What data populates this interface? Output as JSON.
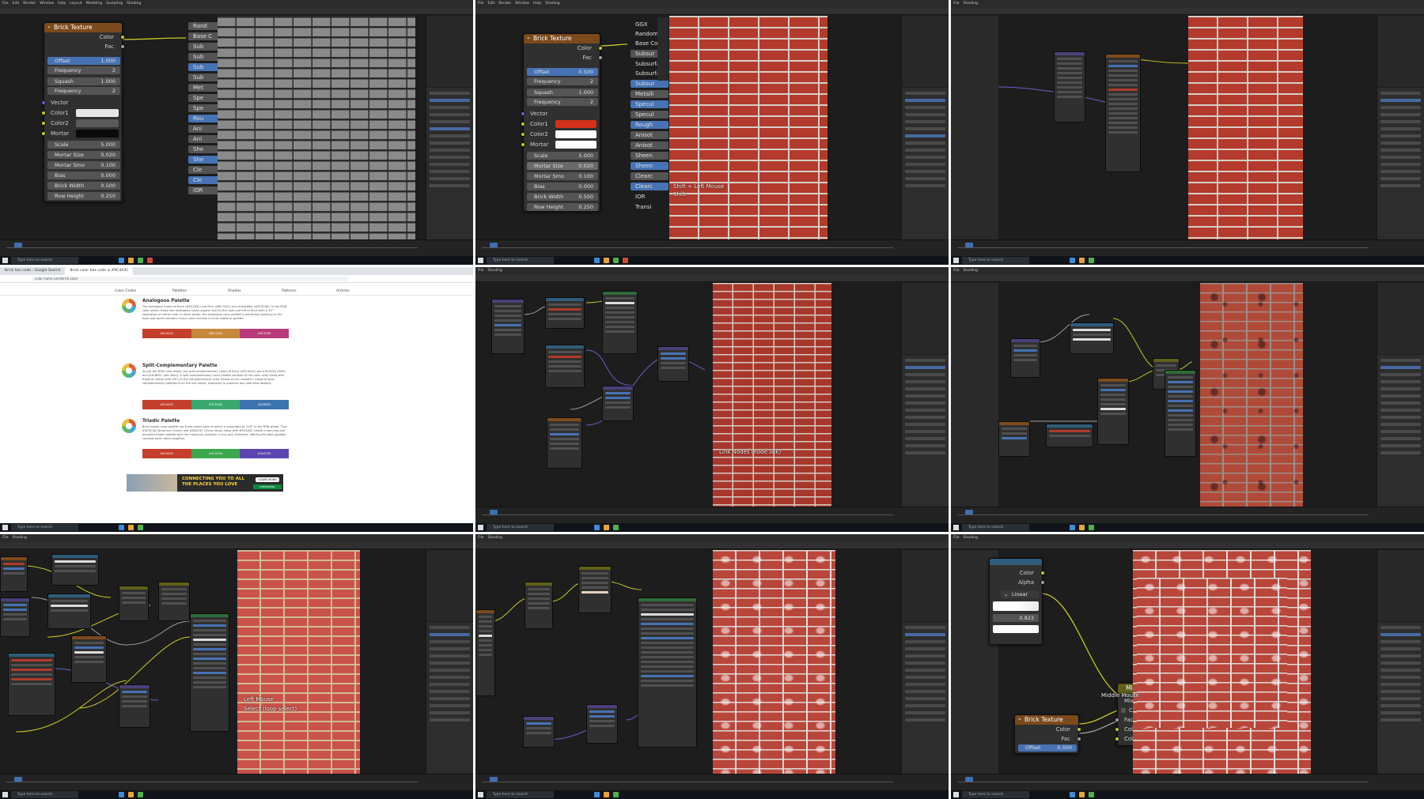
{
  "taskbar": {
    "search_placeholder": "Type here to search"
  },
  "brick_node": {
    "title": "Brick Texture",
    "out_color": "Color",
    "out_fac": "Fac",
    "offset_label": "Offset",
    "frequency_label": "Frequency",
    "squash_label": "Squash",
    "vector_label": "Vector",
    "color1_label": "Color1",
    "color2_label": "Color2",
    "mortar_label": "Mortar",
    "scale_label": "Scale",
    "mortar_size_label": "Mortar Size",
    "mortar_smooth_label": "Mortar Smo",
    "bias_label": "Bias",
    "brick_width_label": "Brick Width",
    "row_height_label": "Row Height"
  },
  "tile1": {
    "offset": "1.000",
    "frequency": "2",
    "squash": "1.000",
    "squash_frequency": "2",
    "scale": "5.000",
    "mortar_size": "0.020",
    "mortar_smooth": "0.100",
    "bias": "0.000",
    "brick_width": "0.500",
    "row_height": "0.250",
    "colors": {
      "color1": "#e6e6e6",
      "color2": "#5a5a5a",
      "mortar": "#0a0a0a"
    },
    "principled_inputs": [
      "Rand",
      "Base C",
      "Sub",
      "Sub",
      "Sub",
      "Sub",
      "Met",
      "Spe",
      "Spe",
      "Rou",
      "Ani",
      "Ani",
      "She",
      "She",
      "Cle",
      "Cle",
      "IOR"
    ]
  },
  "tile2": {
    "offset": "0.500",
    "frequency": "2",
    "squash": "1.000",
    "squash_frequency": "2",
    "scale": "5.000",
    "mortar_size": "0.020",
    "mortar_smooth": "0.100",
    "bias": "0.000",
    "brick_width": "0.500",
    "row_height": "0.250",
    "colors": {
      "color1": "#d4301c",
      "color2": "#ffffff",
      "mortar": "#ffffff"
    },
    "principled_inputs": [
      "GGX",
      "Random",
      "Base Colo",
      "Subsur",
      "Subsurfa",
      "Subsurfa",
      "Subsur",
      "Metalli",
      "Specul",
      "Specul",
      "Rough",
      "Anisot",
      "Anisot",
      "Sheen",
      "Sheen",
      "Clearc",
      "Clearc",
      "IOR",
      "Transi"
    ],
    "overlay_hint": "Shift + Left Mouse",
    "overlay_key": "Shift"
  },
  "tile4_browser": {
    "tabs": [
      "Brick hex code - Google Search",
      "Brick color hex code is #9C4A3C"
    ],
    "url": "color-name.com/brick.color",
    "nav": [
      "Color Codes",
      "Palettes",
      "Shades",
      "Patterns",
      "Articles"
    ],
    "palettes": [
      {
        "title": "Analogous Palette",
        "text": "The analogous colors of Brick (#9C4A3C) are Peru (#BC7A3C) and Irresistible (#9C3C6E). In the RGB color wheel, these two analogous colors appear next to the right and left of Brick with a 30° separation on either side. In other words, the analogous color palette is extremely soothing to the eyes and works wonders if your color scheme is to be subtle or quieter.",
        "swatches": [
          "#9C4A3C",
          "#BC7A3C",
          "#9C3C6E"
        ],
        "colors": [
          "#c4402c",
          "#c8883c",
          "#b83a78"
        ]
      },
      {
        "title": "Split-Complementary Palette",
        "text": "As per the RGB color wheel, the split-complementary colors of Brick (#9C4A3C) are #3C9C6A (Mint) and #3C6E9C (Ibm Blue). A split-complementary color palette consists of the main color along with those on either side (30°) of the complementary color. Based on our research, usage of split-complementary palettes is on the rise online, especially in graphics and web sites designs.",
        "swatches": [
          "#9C4A3C",
          "#3C9C6A",
          "#3C6E9C"
        ],
        "colors": [
          "#c4402c",
          "#3aa86e",
          "#3c74b0"
        ]
      },
      {
        "title": "Triadic Palette",
        "text": "Brick triadic color palette has three colors each of which is separated by 120° in the RGB wheel. Thus #3C9C4A (American Green) and #4A3C9C (Ocean Blue) along with #9C4A3C create a stunning and beautiful triadic palette with the maximum variation in hue and, therefore, offering the best possible contrast when taken together.",
        "swatches": [
          "#9C4A3C",
          "#3C9C4A",
          "#4A3C9C"
        ],
        "colors": [
          "#c4402c",
          "#3ca84e",
          "#5a46b0"
        ]
      }
    ],
    "ad_text": "CONNECTING YOU TO ALL THE PLACES YOU LOVE",
    "ad_button": "LEARN MORE",
    "ad_brand": "enterprise"
  },
  "tile5": {
    "overlay_hint": "Link Nodes (node.link)"
  },
  "tile7": {
    "overlay_hint": "Left Mouse",
    "overlay_sub": "Select (loop select)"
  },
  "tile9": {
    "out_color": "Color",
    "out_alpha": "Alpha",
    "interp": "Linear",
    "ramp_value": "0.823",
    "mix_title": "Mix",
    "mix_clamp": "Clamp",
    "mix_fac": "Fac",
    "mix_color1": "Color1",
    "mix_color2": "Color2",
    "brick_offset": "0.500",
    "brick_frequency": "2",
    "overlay_hint": "Middle Mouse"
  },
  "blender_menu": [
    "File",
    "Edit",
    "Render",
    "Window",
    "Help",
    "Layout",
    "Modeling",
    "Sculpting",
    "UV Editing",
    "Texture Paint",
    "Shading",
    "Animation"
  ]
}
